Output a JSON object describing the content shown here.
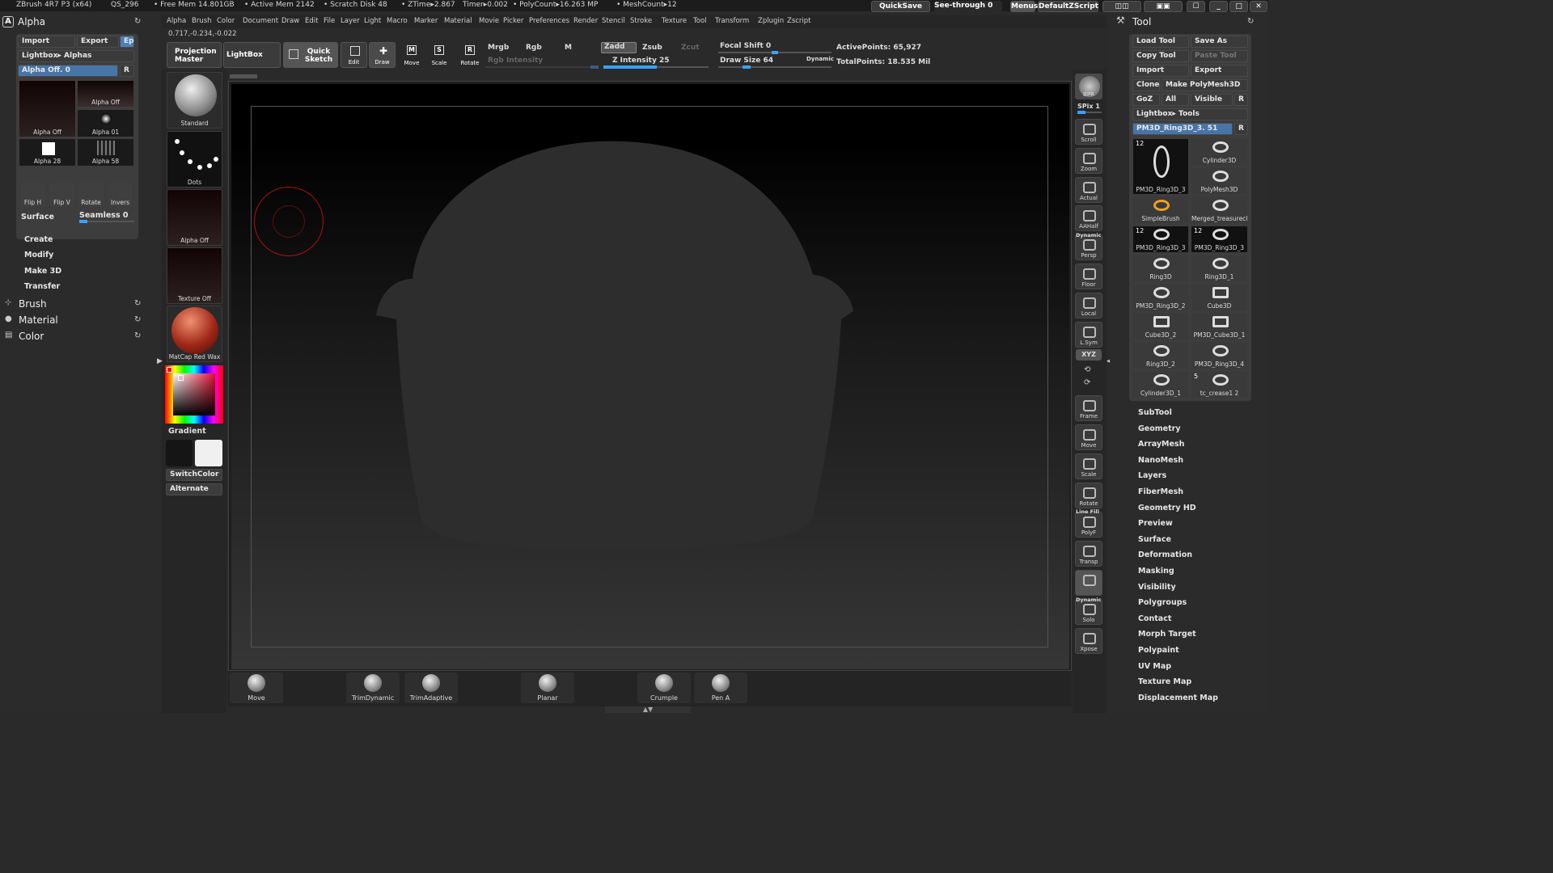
{
  "titlebar": {
    "app": "ZBrush 4R7 P3 (x64)",
    "qs": "QS_296",
    "free_mem": "• Free Mem 14.801GB",
    "active_mem": "• Active Mem 2142",
    "scratch": "• Scratch Disk 48",
    "ztime": "• ZTime▸2.867",
    "timer": "Timer▸0.002",
    "polycount": "• PolyCount▸16.263 MP",
    "meshcount": "• MeshCount▸12",
    "quicksave": "QuickSave",
    "seethrough": "See-through  0",
    "menus": "Menus",
    "script": "DefaultZScript"
  },
  "menubar": [
    "Alpha",
    "Brush",
    "Color",
    "Document",
    "Draw",
    "Edit",
    "File",
    "Layer",
    "Light",
    "Macro",
    "Marker",
    "Material",
    "Movie",
    "Picker",
    "Preferences",
    "Render",
    "Stencil",
    "Stroke",
    "Texture",
    "Tool",
    "Transform",
    "Zplugin",
    "Zscript"
  ],
  "coords": "0.717,-0.234,-0.022",
  "shelf": {
    "projection_master": "Projection Master",
    "lightbox": "LightBox",
    "quick_sketch": "Quick Sketch",
    "edit": "Edit",
    "draw": "Draw",
    "move": "Move",
    "scale": "Scale",
    "rotate": "Rotate",
    "mrgb": "Mrgb",
    "rgb": "Rgb",
    "m": "M",
    "rgb_intensity": "Rgb Intensity",
    "zadd": "Zadd",
    "zsub": "Zsub",
    "zcut": "Zcut",
    "z_intensity": "Z Intensity 25",
    "focal_shift": "Focal Shift 0",
    "draw_size": "Draw Size 64",
    "dynamic": "Dynamic",
    "active_points": "ActivePoints: 65,927",
    "total_points": "TotalPoints: 18.535 Mil"
  },
  "alpha_panel": {
    "title": "Alpha",
    "import": "Import",
    "export": "Export",
    "ep": "Ep",
    "lightbox_alphas": "Lightbox▸ Alphas",
    "alpha_off": "Alpha  Off. 0",
    "r": "R",
    "thumbs": [
      "Alpha  Off",
      "Alpha  Off",
      "Alpha  01",
      "Alpha  28",
      "Alpha  58"
    ],
    "flip_h": "Flip H",
    "flip_v": "Flip V",
    "rotate": "Rotate",
    "invers": "Invers",
    "surface": "Surface",
    "seamless": "Seamless 0",
    "subs": [
      "Create",
      "Modify",
      "Make 3D",
      "Transfer"
    ],
    "sections": [
      "Brush",
      "Material",
      "Color"
    ]
  },
  "left_tray": {
    "brush": "Standard",
    "stroke": "Dots",
    "alpha": "Alpha  Off",
    "texture": "Texture  Off",
    "material": "MatCap  Red  Wax",
    "gradient": "Gradient",
    "switchcolor": "SwitchColor",
    "alternate": "Alternate",
    "colors": {
      "main": "#151515",
      "secondary": "#f0f0f0"
    }
  },
  "right_tray": {
    "bpr": "BPR",
    "spix": "SPix 1",
    "items": [
      "Scroll",
      "Zoom",
      "Actual",
      "AAHalf",
      "Persp",
      "Floor",
      "Local",
      "L.Sym",
      "XYZ",
      "Frame",
      "Move",
      "Scale",
      "Rotate",
      "PolyF",
      "Transp",
      "Ghost",
      "Solo",
      "Xpose"
    ],
    "dynamic": "Dynamic",
    "line_fill": "Line Fill"
  },
  "tool_panel": {
    "title": "Tool",
    "load_tool": "Load  Tool",
    "save_as": "Save  As",
    "copy_tool": "Copy  Tool",
    "paste_tool": "Paste  Tool",
    "import": "Import",
    "export": "Export",
    "clone": "Clone",
    "make_polymesh": "Make  PolyMesh3D",
    "goz": "GoZ",
    "all": "All",
    "visible": "Visible",
    "r": "R",
    "lightbox_tools": "Lightbox▸ Tools",
    "current": "PM3D_Ring3D_3. 51",
    "tools": [
      {
        "name": "PM3D_Ring3D_3",
        "count": "12"
      },
      {
        "name": "Cylinder3D",
        "count": ""
      },
      {
        "name": "SimpleBrush",
        "count": ""
      },
      {
        "name": "PolyMesh3D",
        "count": ""
      },
      {
        "name": "Merged_treasurecl",
        "count": ""
      },
      {
        "name": "PM3D_Ring3D_3",
        "count": "12"
      },
      {
        "name": "PM3D_Ring3D_3",
        "count": "12"
      },
      {
        "name": "Ring3D",
        "count": ""
      },
      {
        "name": "Ring3D_1",
        "count": ""
      },
      {
        "name": "PM3D_Ring3D_2",
        "count": ""
      },
      {
        "name": "Cube3D",
        "count": ""
      },
      {
        "name": "Cube3D_2",
        "count": ""
      },
      {
        "name": "PM3D_Cube3D_1",
        "count": ""
      },
      {
        "name": "Ring3D_2",
        "count": ""
      },
      {
        "name": "PM3D_Ring3D_4",
        "count": ""
      },
      {
        "name": "Cylinder3D_1",
        "count": ""
      },
      {
        "name": "tc_crease1 2",
        "count": "5"
      }
    ],
    "subpalettes": [
      "SubTool",
      "Geometry",
      "ArrayMesh",
      "NanoMesh",
      "Layers",
      "FiberMesh",
      "Geometry HD",
      "Preview",
      "Surface",
      "Deformation",
      "Masking",
      "Visibility",
      "Polygroups",
      "Contact",
      "Morph Target",
      "Polypaint",
      "UV Map",
      "Texture Map",
      "Displacement Map"
    ]
  },
  "bottom_brushes": [
    "Move",
    "TrimDynamic",
    "TrimAdaptive",
    "Planar",
    "Crumple",
    "Pen A"
  ]
}
